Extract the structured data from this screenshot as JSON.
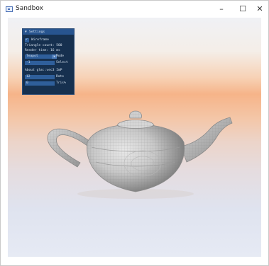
{
  "window": {
    "title": "Sandbox",
    "minimize_glyph": "–",
    "maximize_glyph": "☐",
    "close_glyph": "✕"
  },
  "panel": {
    "title": "Settings",
    "wireframe_label": "Wireframe",
    "triangle_count": "Triangle count: 500",
    "render_time": "Render time: 16 ms",
    "target_combo": "Teapot",
    "mode_label": "Mode",
    "select_value": "-1",
    "select_label": "Select",
    "about_text": "About glm::vec3 ImP",
    "row9_value": "12",
    "row9_label": "Rate",
    "row10_value": "0",
    "row10_label": "Tris%"
  }
}
